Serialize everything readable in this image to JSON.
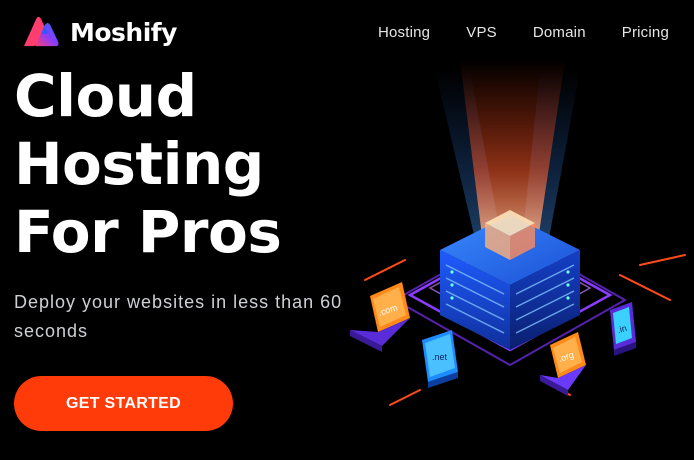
{
  "brand": {
    "name": "Moshify",
    "colors": {
      "gradient_start": "#ff3d6e",
      "gradient_mid": "#8a3cff",
      "gradient_end": "#1e6bff"
    }
  },
  "nav": {
    "items": [
      {
        "label": "Hosting"
      },
      {
        "label": "VPS"
      },
      {
        "label": "Domain"
      },
      {
        "label": "Pricing"
      }
    ]
  },
  "hero": {
    "title_lines": [
      "Cloud",
      "Hosting",
      "For Pros"
    ],
    "subtitle": "Deploy your websites in less than 60 seconds",
    "cta_label": "GET STARTED",
    "cta_color": "#ff3b0a"
  },
  "illustration": {
    "domain_labels": [
      ".com",
      ".net",
      ".org",
      ".in"
    ]
  }
}
